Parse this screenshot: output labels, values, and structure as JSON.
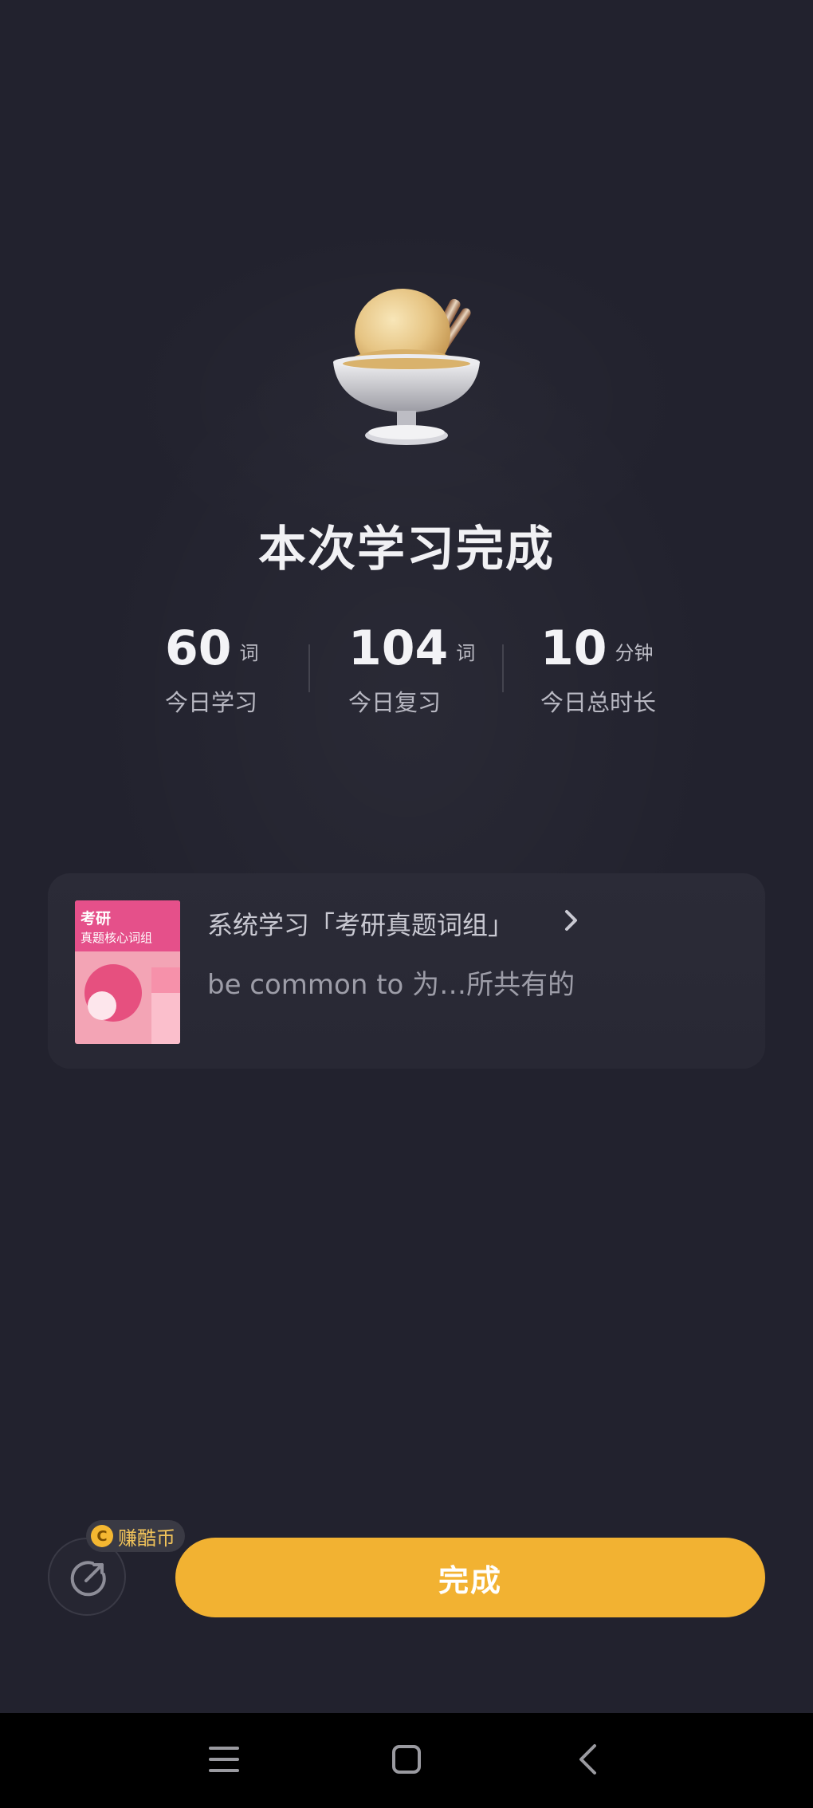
{
  "summary": {
    "title": "本次学习完成"
  },
  "stats": [
    {
      "value": "60",
      "unit": "词",
      "label": "今日学习"
    },
    {
      "value": "104",
      "unit": "词",
      "label": "今日复习"
    },
    {
      "value": "10",
      "unit": "分钟",
      "label": "今日总时长"
    }
  ],
  "book_card": {
    "cover_title": "考研",
    "cover_subtitle": "真题核心词组",
    "title": "系统学习「考研真题词组」",
    "example": "be common to 为…所共有的"
  },
  "actions": {
    "coin_badge": "赚酷币",
    "coin_symbol": "C",
    "done_label": "完成"
  },
  "colors": {
    "background": "#22222e",
    "accent": "#f2b232",
    "cover_pink": "#e5508a"
  },
  "icons": {
    "hero": "ice-cream-icon",
    "share": "share-icon",
    "chevron": "chevron-right-icon",
    "nav": [
      "menu-icon",
      "home-square-icon",
      "back-icon"
    ]
  }
}
